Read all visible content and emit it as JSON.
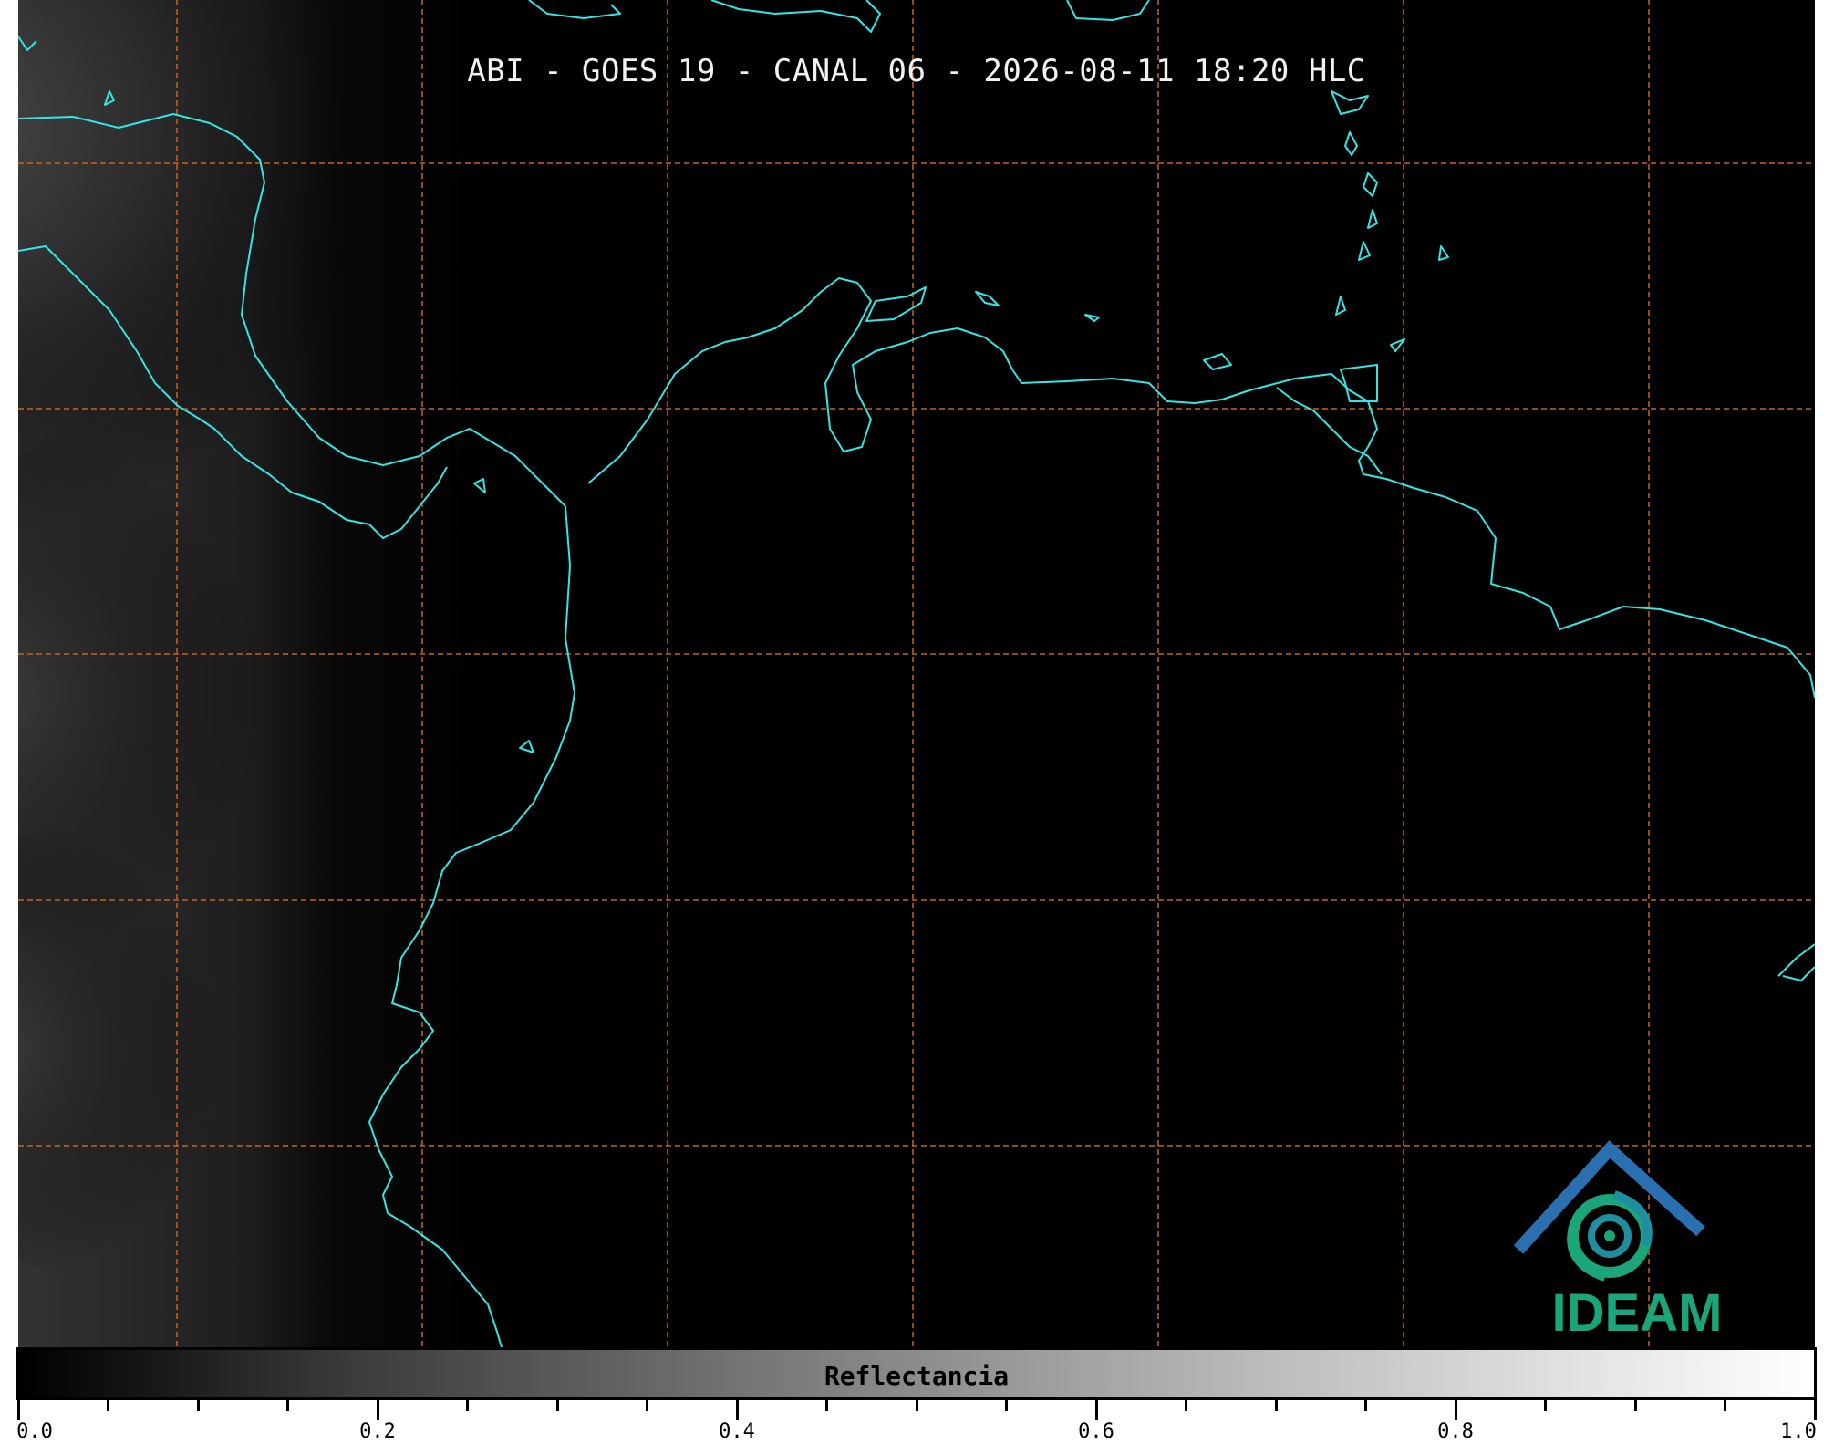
{
  "title": "ABI - GOES 19 - CANAL 06 - 2026-08-11 18:20 HLC",
  "colorbar": {
    "label": "Reflectancia",
    "tick_labels": [
      "0.0",
      "0.2",
      "0.4",
      "0.6",
      "0.8",
      "1.0"
    ],
    "min": 0.0,
    "max": 1.0
  },
  "logo_text": "IDEAM",
  "colors": {
    "coastline": "#33e6e6",
    "gridlines": "#c8641e",
    "background": "#000000",
    "logo_green": "#1aa57a",
    "logo_blue": "#2a6fb0"
  },
  "icons": [
    "ideam-logo-icon"
  ]
}
